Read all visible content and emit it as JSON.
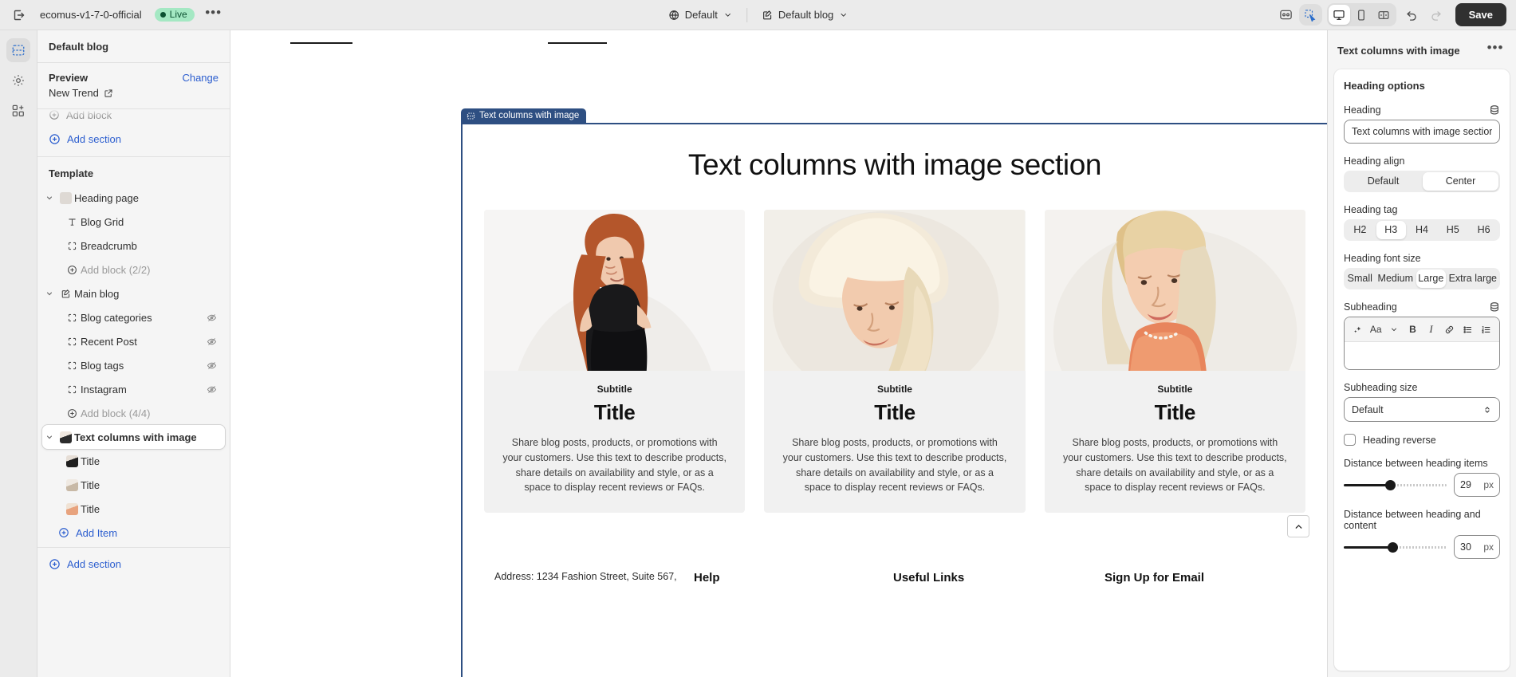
{
  "topbar": {
    "exit_icon": "exit-icon",
    "theme_name": "ecomus-v1-7-0-official",
    "live_label": "Live",
    "more_label": "•••",
    "locale_selector": {
      "icon": "globe-icon",
      "value": "Default"
    },
    "template_selector": {
      "icon": "edit-page-icon",
      "value": "Default blog"
    },
    "inspector_icon": "inspector-icon",
    "select_tool_icon": "cursor-select-icon",
    "devices": [
      {
        "name": "desktop",
        "icon": "desktop-icon",
        "active": true
      },
      {
        "name": "mobile",
        "icon": "mobile-icon",
        "active": false
      },
      {
        "name": "fullscreen",
        "icon": "fullwidth-icon",
        "active": false
      }
    ],
    "undo_icon": "undo-icon",
    "redo_icon": "redo-icon",
    "save_label": "Save"
  },
  "rail": {
    "items": [
      {
        "name": "sections",
        "icon": "sections-icon",
        "active": true
      },
      {
        "name": "settings",
        "icon": "gear-icon",
        "active": false
      },
      {
        "name": "apps",
        "icon": "apps-add-icon",
        "active": false
      }
    ]
  },
  "sidebar": {
    "title": "Default blog",
    "preview_label": "Preview",
    "change_label": "Change",
    "preview_value": "New Trend",
    "top_add_block": "Add block",
    "top_add_section": "Add section",
    "template_label": "Template",
    "tree": [
      {
        "label": "Heading page",
        "icon": "image-thumb",
        "level": 0,
        "caret": true
      },
      {
        "label": "Blog Grid",
        "icon": "text-icon",
        "level": 1
      },
      {
        "label": "Breadcrumb",
        "icon": "block-icon",
        "level": 1
      },
      {
        "label": "Add block (2/2)",
        "icon": "plus-circle-icon",
        "level": 1,
        "muted": true
      },
      {
        "label": "Main blog",
        "icon": "edit-page-icon",
        "level": 0,
        "caret": true
      },
      {
        "label": "Blog categories",
        "icon": "block-icon",
        "level": 1,
        "eye": true
      },
      {
        "label": "Recent Post",
        "icon": "block-icon",
        "level": 1,
        "eye": true
      },
      {
        "label": "Blog tags",
        "icon": "block-icon",
        "level": 1,
        "eye": true
      },
      {
        "label": "Instagram",
        "icon": "block-icon",
        "level": 1,
        "eye": true
      },
      {
        "label": "Add block (4/4)",
        "icon": "plus-circle-icon",
        "level": 1,
        "muted": true
      },
      {
        "label": "Text columns with image",
        "icon": "image-thumb",
        "level": 0,
        "caret": true,
        "selected": true
      },
      {
        "label": "Title",
        "icon": "image-thumb",
        "level": 1
      },
      {
        "label": "Title",
        "icon": "image-thumb",
        "level": 1
      },
      {
        "label": "Title",
        "icon": "image-thumb",
        "level": 1
      }
    ],
    "add_item": "Add Item",
    "add_section": "Add section"
  },
  "canvas": {
    "selected_tab_label": "Text columns with image",
    "section_heading": "Text columns with image section",
    "columns": [
      {
        "subtitle": "Subtitle",
        "title": "Title",
        "body": "Share blog posts, products, or promotions with your customers. Use this text to describe products, share details on availability and style, or as a space to display recent reviews or FAQs."
      },
      {
        "subtitle": "Subtitle",
        "title": "Title",
        "body": "Share blog posts, products, or promotions with your customers. Use this text to describe products, share details on availability and style, or as a space to display recent reviews or FAQs."
      },
      {
        "subtitle": "Subtitle",
        "title": "Title",
        "body": "Share blog posts, products, or promotions with your customers. Use this text to describe products, share details on availability and style, or as a space to display recent reviews or FAQs."
      }
    ],
    "back_to_top_icon": "chevron-up-icon",
    "footer": {
      "address": "Address: 1234 Fashion Street, Suite 567,",
      "col_help": "Help",
      "col_useful": "Useful Links",
      "col_signup": "Sign Up for Email"
    }
  },
  "inspector": {
    "title": "Text columns with image",
    "more_icon": "ellipsis-icon",
    "section_title": "Heading options",
    "heading": {
      "label": "Heading",
      "value": "Text columns with image section",
      "source_icon": "dynamic-source-icon"
    },
    "heading_align": {
      "label": "Heading align",
      "options": [
        "Default",
        "Center"
      ],
      "selected": "Center"
    },
    "heading_tag": {
      "label": "Heading tag",
      "options": [
        "H2",
        "H3",
        "H4",
        "H5",
        "H6"
      ],
      "selected": "H3"
    },
    "heading_font_size": {
      "label": "Heading font size",
      "options": [
        "Small",
        "Medium",
        "Large",
        "Extra large"
      ],
      "selected": "Large"
    },
    "subheading": {
      "label": "Subheading",
      "value": "",
      "source_icon": "dynamic-source-icon",
      "toolbar": [
        {
          "name": "ai-magic-icon",
          "glyph": "✧"
        },
        {
          "name": "font-style-icon",
          "glyph": "Aa"
        },
        {
          "name": "chevron-down-icon",
          "glyph": "⌄"
        },
        {
          "name": "bold-icon",
          "glyph": "B"
        },
        {
          "name": "italic-icon",
          "glyph": "I"
        },
        {
          "name": "link-icon",
          "glyph": "ὑ7"
        },
        {
          "name": "bullet-list-icon",
          "glyph": "☰"
        },
        {
          "name": "numbered-list-icon",
          "glyph": "≣"
        }
      ]
    },
    "subheading_size": {
      "label": "Subheading size",
      "value": "Default"
    },
    "heading_reverse": {
      "label": "Heading reverse",
      "checked": false
    },
    "distance_heading_items": {
      "label": "Distance between heading items",
      "value": "29",
      "unit": "px",
      "percent": 48
    },
    "distance_heading_content": {
      "label": "Distance between heading and content",
      "value": "30",
      "unit": "px",
      "percent": 50
    }
  },
  "colors": {
    "accent_blue": "#2c5ecf",
    "selection_blue": "#2e4f82",
    "live_green": "#a4e8c3",
    "save_dark": "#303030"
  }
}
